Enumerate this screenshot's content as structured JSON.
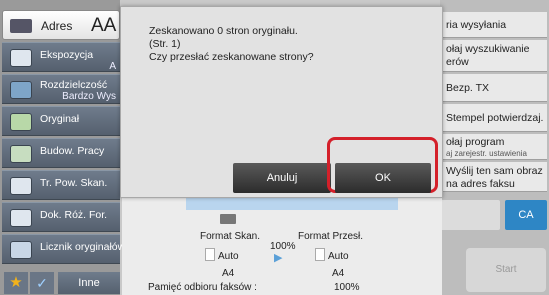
{
  "sidebar": {
    "address_label": "Adres",
    "address_aa": "AA",
    "items": [
      {
        "label": "Ekspozycja",
        "sub": "A"
      },
      {
        "label": "Rozdzielczość",
        "sub": "Bardzo Wys"
      },
      {
        "label": "Oryginał",
        "sub": ""
      },
      {
        "label": "Budow. Pracy",
        "sub": ""
      },
      {
        "label": "Tr. Pow. Skan.",
        "sub": ""
      },
      {
        "label": "Dok. Róż. For.",
        "sub": ""
      },
      {
        "label": "Licznik oryginałów",
        "sub": ""
      }
    ],
    "other_label": "Inne"
  },
  "right_panel": {
    "items": [
      {
        "label": "ria wysyłania",
        "small": ""
      },
      {
        "label": "ołaj wyszukiwanie",
        "line2": "erów",
        "small": ""
      },
      {
        "label": "Bezp. TX",
        "small": ""
      },
      {
        "label": "Stempel potwierdzaj.",
        "small": ""
      },
      {
        "label": "ołaj program",
        "small": "aj zarejestr. ustawienia"
      },
      {
        "label": "Wyślij ten sam obraz",
        "line2": "na adres faksu",
        "small": ""
      }
    ],
    "ca_label": "CA",
    "start_label": "Start"
  },
  "center": {
    "scan_format_label": "Format Skan.",
    "send_format_label": "Format Przesł.",
    "scan_auto": "Auto",
    "send_auto": "Auto",
    "scan_size": "A4",
    "send_size": "A4",
    "ratio": "100%",
    "fax_memory_label": "Pamięć odbioru faksów :",
    "fax_memory_value": "100%"
  },
  "dialog": {
    "line1": "Zeskanowano 0 stron oryginału.",
    "line2": "(Str. 1)",
    "line3": "Czy przesłać zeskanowane strony?",
    "cancel_label": "Anuluj",
    "ok_label": "OK"
  },
  "colors": {
    "accent_blue": "#2e86c5",
    "highlight_red": "#d4202a",
    "dialog_bg": "#e2e2e2",
    "sidebar_btn": "#5d6a7a"
  }
}
